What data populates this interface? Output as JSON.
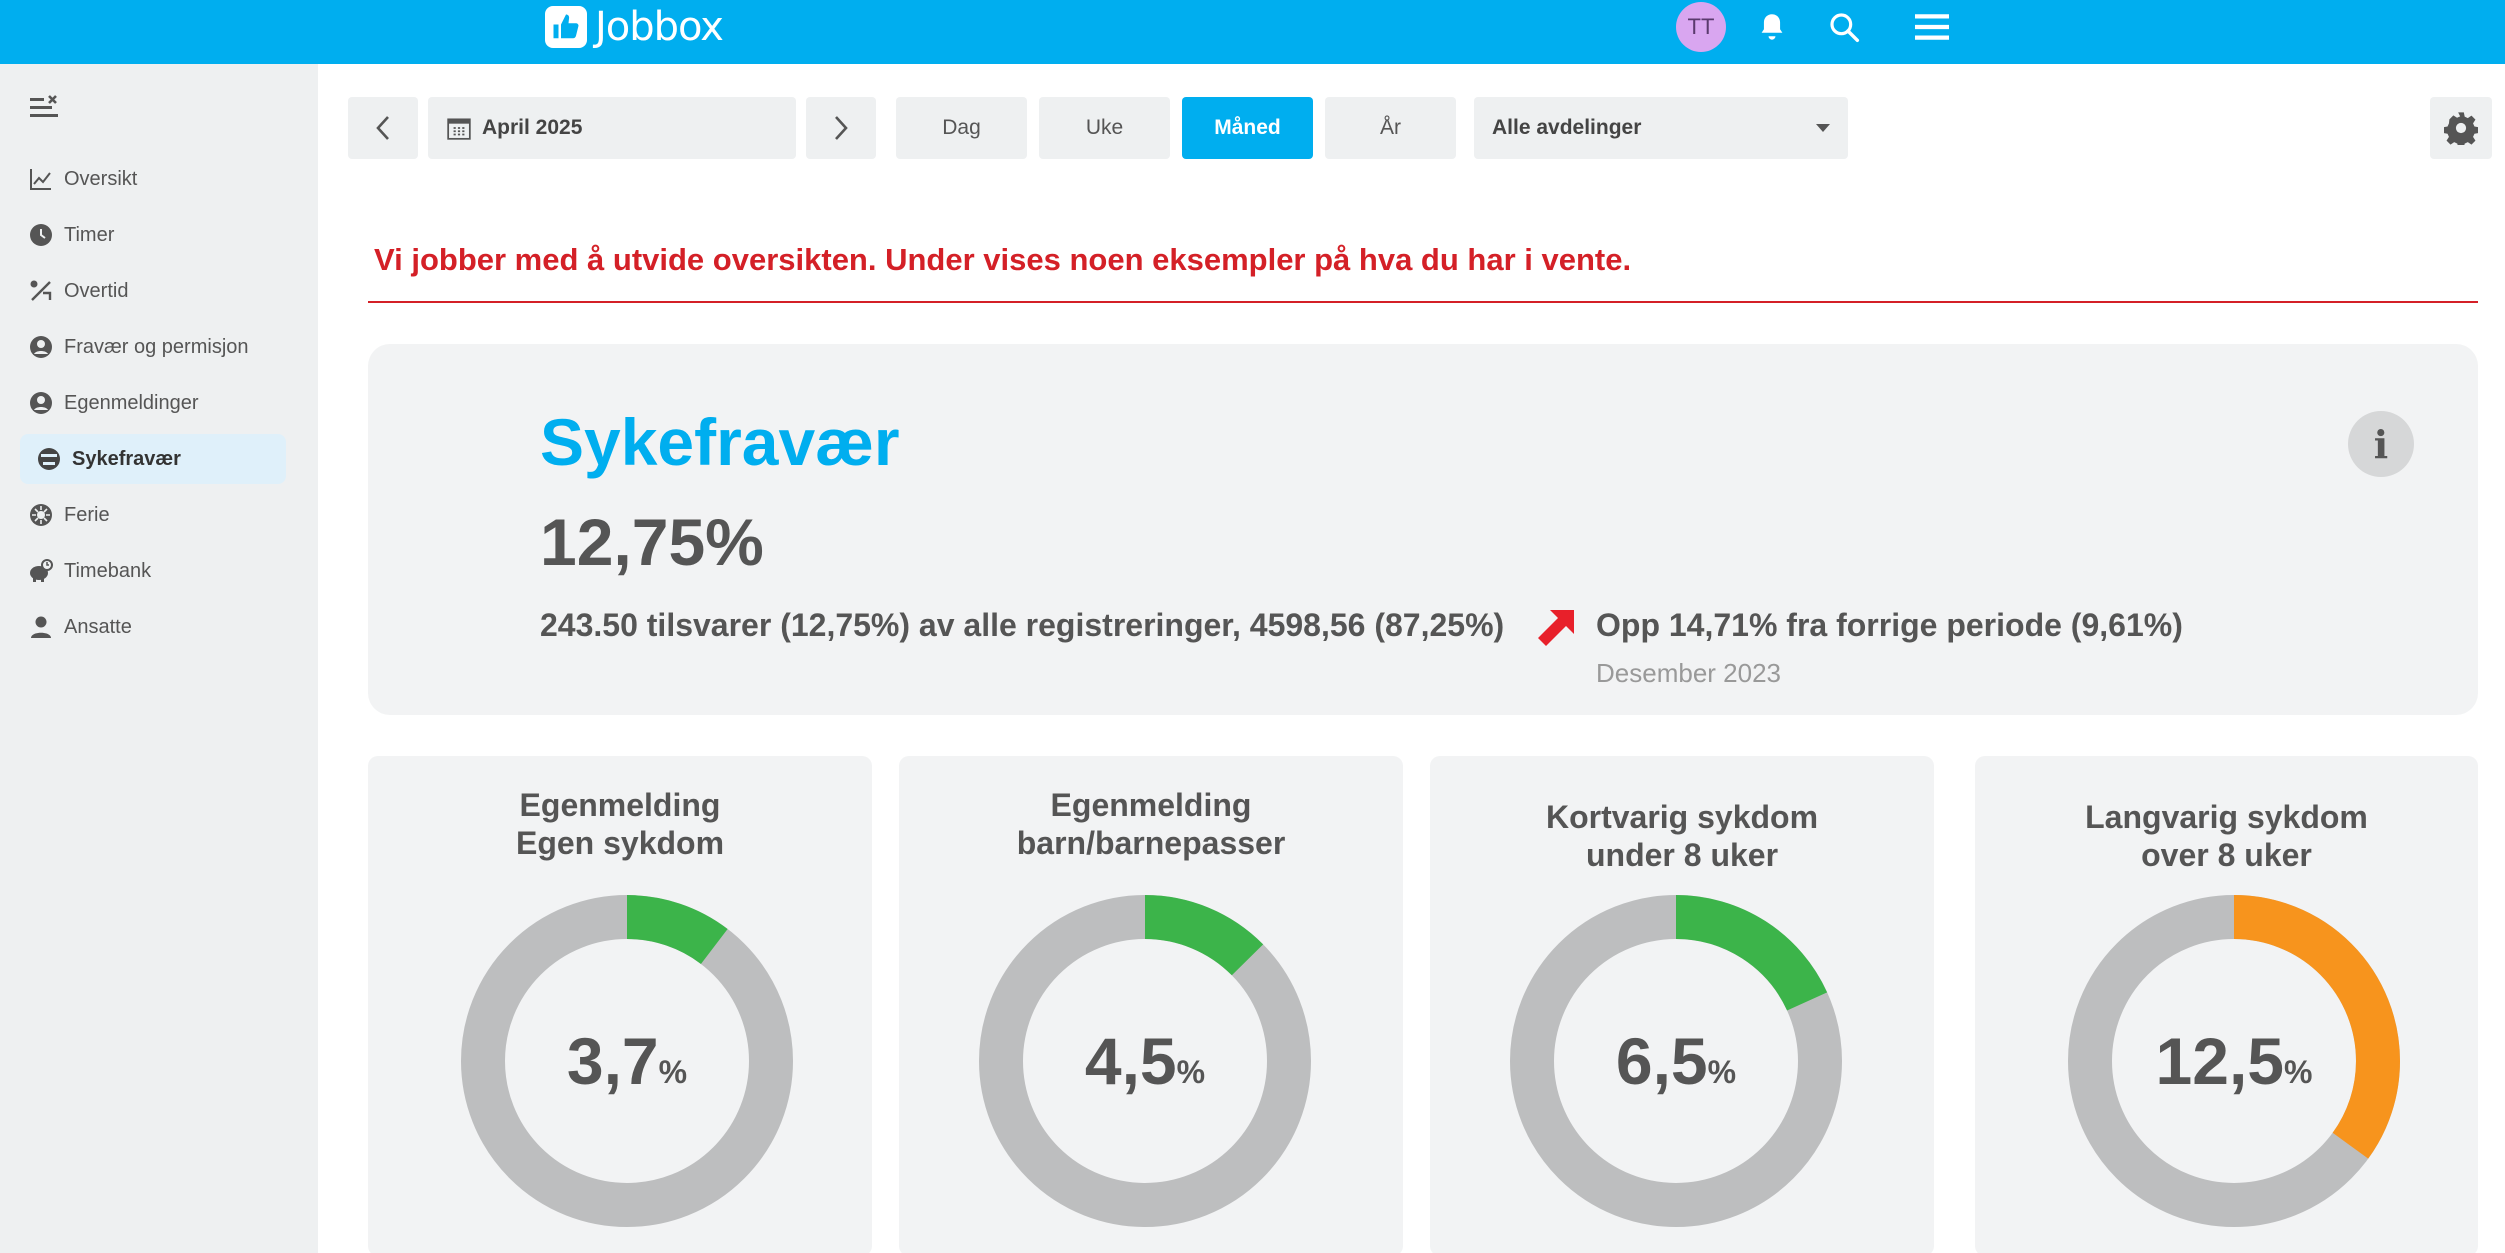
{
  "header": {
    "logo_text": "Jobbox",
    "avatar_initials": "TT",
    "icons": [
      "bell-icon",
      "search-icon",
      "hamburger-menu-icon"
    ]
  },
  "sidebar": {
    "items": [
      {
        "label": "Oversikt",
        "icon": "line-chart-icon"
      },
      {
        "label": "Timer",
        "icon": "clock-icon"
      },
      {
        "label": "Overtid",
        "icon": "overtime-icon"
      },
      {
        "label": "Fravær og permisjon",
        "icon": "user-circle-icon"
      },
      {
        "label": "Egenmeldinger",
        "icon": "user-circle-icon"
      },
      {
        "label": "Sykefravær",
        "icon": "sick-face-icon",
        "active": true
      },
      {
        "label": "Ferie",
        "icon": "sun-icon"
      },
      {
        "label": "Timebank",
        "icon": "piggy-bank-icon"
      },
      {
        "label": "Ansatte",
        "icon": "person-icon"
      }
    ]
  },
  "toolbar": {
    "date_label": "April 2025",
    "tabs": [
      "Dag",
      "Uke",
      "Måned",
      "År"
    ],
    "active_tab": "Måned",
    "department_select": "Alle avdelinger"
  },
  "banner": {
    "text": "Vi jobber med å utvide oversikten. Under vises noen eksempler på hva du har i vente."
  },
  "summary": {
    "title": "Sykefravær",
    "value": "12,75%",
    "description": "243.50 tilsvarer (12,75%) av alle registreringer, 4598,56 (87,25%)",
    "change": "Opp 14,71% fra forrige periode (9,61%)",
    "previous_period": "Desember 2023"
  },
  "colors": {
    "brand": "#00aeef",
    "alert": "#d42027",
    "donut_track": "#bdbebf",
    "donut_green": "#3cb44a",
    "donut_orange": "#f7941d"
  },
  "chart_data": [
    {
      "type": "pie",
      "title_line1": "Egenmelding",
      "title_line2": "Egen sykdom",
      "value_text": "3,7",
      "unit": "%",
      "value": 3.7,
      "color": "#3cb44a"
    },
    {
      "type": "pie",
      "title_line1": "Egenmelding",
      "title_line2": "barn/barnepasser",
      "value_text": "4,5",
      "unit": "%",
      "value": 4.5,
      "color": "#3cb44a"
    },
    {
      "type": "pie",
      "title_line1": "Kortvarig sykdom",
      "title_line2": "under 8 uker",
      "value_text": "6,5",
      "unit": "%",
      "value": 6.5,
      "color": "#3cb44a"
    },
    {
      "type": "pie",
      "title_line1": "Langvarig sykdom",
      "title_line2": "over 8 uker",
      "value_text": "12,5",
      "unit": "%",
      "value": 12.5,
      "color": "#f7941d"
    }
  ]
}
